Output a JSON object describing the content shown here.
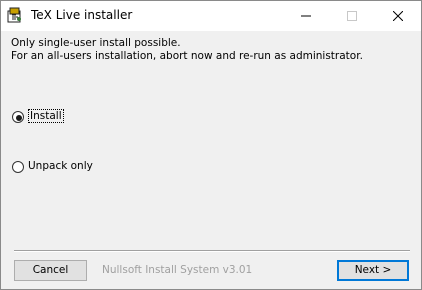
{
  "window": {
    "title": "TeX Live installer",
    "controls": {
      "minimize_icon": "minimize-icon",
      "maximize_icon": "maximize-icon",
      "close_icon": "close-icon"
    }
  },
  "message": {
    "line1": "Only single-user install possible.",
    "line2": "For an all-users installation, abort now and re-run as administrator."
  },
  "options": [
    {
      "label": "Install",
      "selected": true
    },
    {
      "label": "Unpack only",
      "selected": false
    }
  ],
  "footer": {
    "cancel_label": "Cancel",
    "branding": "Nullsoft Install System v3.01",
    "next_label": "Next >"
  }
}
